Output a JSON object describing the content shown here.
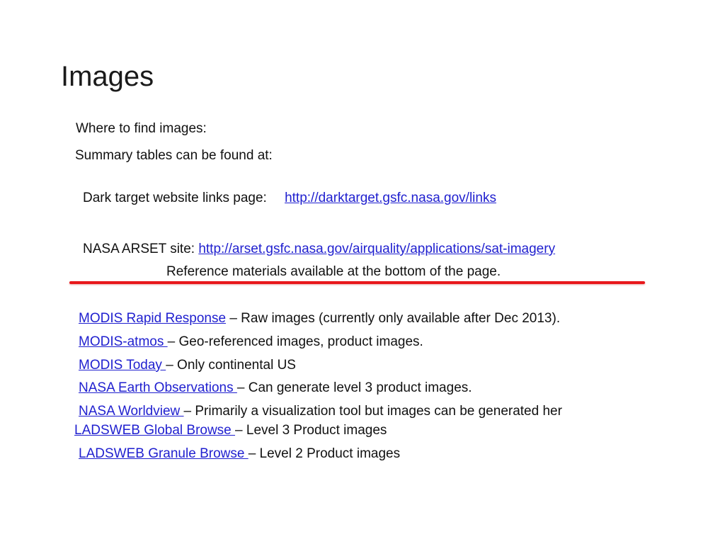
{
  "slide": {
    "title": "Images",
    "intro": "Where to find images:",
    "summary": "Summary tables can be found at:",
    "dark_target": {
      "label": "Dark target website links page:",
      "url": "http://darktarget.gsfc.nasa.gov/links"
    },
    "arset": {
      "label": "NASA ARSET site: ",
      "url": "http://arset.gsfc.nasa.gov/airquality/applications/sat-imagery",
      "note": "Reference materials available at the bottom of the page."
    },
    "divider_color": "#e8181b",
    "links": [
      {
        "link": "MODIS Rapid Response",
        "desc": " – Raw images  (currently only available after Dec 2013)."
      },
      {
        "link": "MODIS-atmos ",
        "desc": "– Geo-referenced images, product images."
      },
      {
        "link": "MODIS Today ",
        "desc": "– Only continental US"
      },
      {
        "link": "NASA Earth Observations ",
        "desc": "– Can generate level 3 product images."
      },
      {
        "link": "NASA Worldview ",
        "desc": "– Primarily a visualization tool but images can be generated her"
      },
      {
        "link": "LADSWEB Global Browse ",
        "desc": "–  Level 3 Product images"
      },
      {
        "link": "LADSWEB Granule Browse ",
        "desc": "– Level 2 Product images"
      }
    ]
  }
}
